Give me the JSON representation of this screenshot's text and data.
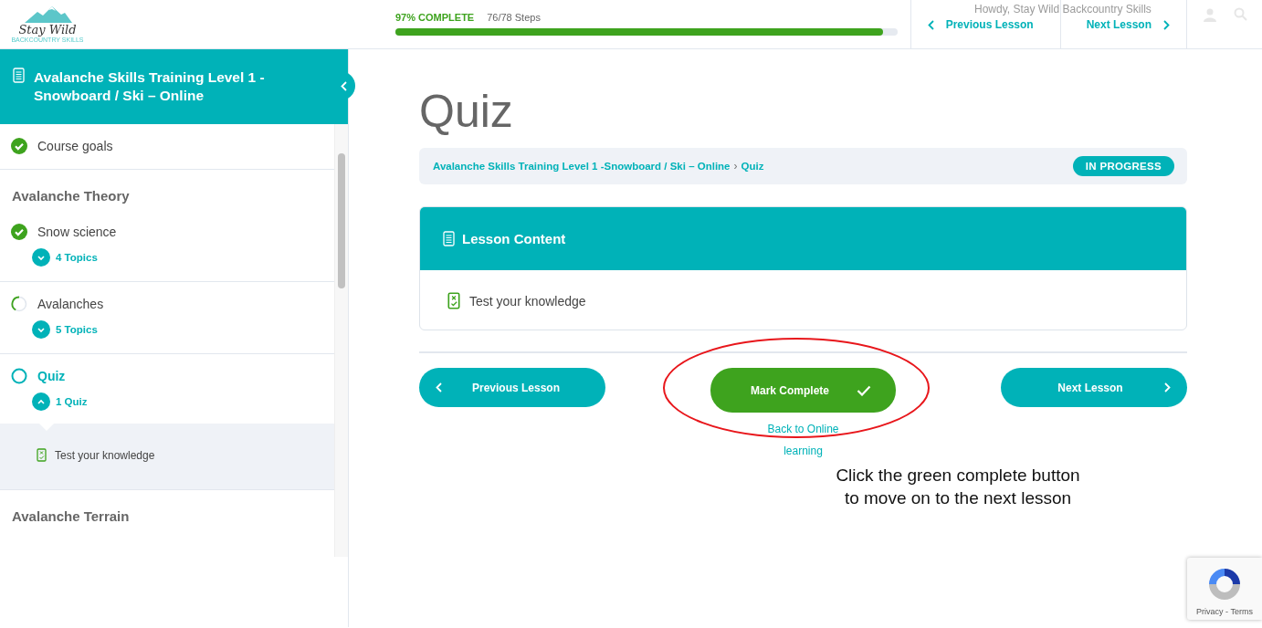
{
  "header": {
    "logo": {
      "script": "Stay Wild",
      "tagline": "BACKCOUNTRY SKILLS"
    },
    "progress": {
      "label": "97% COMPLETE",
      "steps": "76/78 Steps",
      "level": 0.97
    },
    "greeting": "Howdy, Stay Wild Backcountry Skills",
    "nav": [
      {
        "kind": "prev",
        "label": "Previous Lesson"
      },
      {
        "kind": "next",
        "label": "Next Lesson"
      }
    ]
  },
  "sidebar": {
    "course_title": "Avalanche Skills Training Level 1 - Snowboard / Ski – Online",
    "items": [
      {
        "kind": "lesson",
        "label": "Course goals",
        "completed": true,
        "selected": false
      },
      {
        "kind": "section",
        "label": "Avalanche Theory"
      },
      {
        "kind": "lesson",
        "label": "Snow science",
        "completed": true,
        "selected": false,
        "toggle": "4 Topics",
        "expanded": false
      },
      {
        "kind": "lesson",
        "label": "Avalanches",
        "completed": false,
        "started": true,
        "selected": false,
        "toggle": "5 Topics",
        "expanded": false
      },
      {
        "kind": "lesson",
        "label": "Quiz",
        "completed": false,
        "started": false,
        "selected": true,
        "toggle": "1 Quiz",
        "expanded": true,
        "children": [
          {
            "label": "Test your knowledge"
          }
        ]
      },
      {
        "kind": "section",
        "label": "Avalanche Terrain"
      }
    ]
  },
  "main": {
    "title": "Quiz",
    "breadcrumb": [
      {
        "label": "Avalanche Skills Training Level 1 -Snowboard / Ski – Online"
      },
      {
        "label": "Quiz"
      }
    ],
    "breadcrumb_separator": "›",
    "status_badge": "IN PROGRESS",
    "lesson_content": {
      "heading": "Lesson Content",
      "items": [
        {
          "label": "Test your knowledge"
        }
      ]
    },
    "footer": {
      "previous": "Previous Lesson",
      "mark_complete": "Mark Complete",
      "back_link": "Back to Online learning",
      "next": "Next Lesson"
    }
  },
  "annotation": {
    "text": "Click the green complete button to move on to the next lesson"
  },
  "recaptcha": {
    "label": "Privacy - Terms"
  }
}
